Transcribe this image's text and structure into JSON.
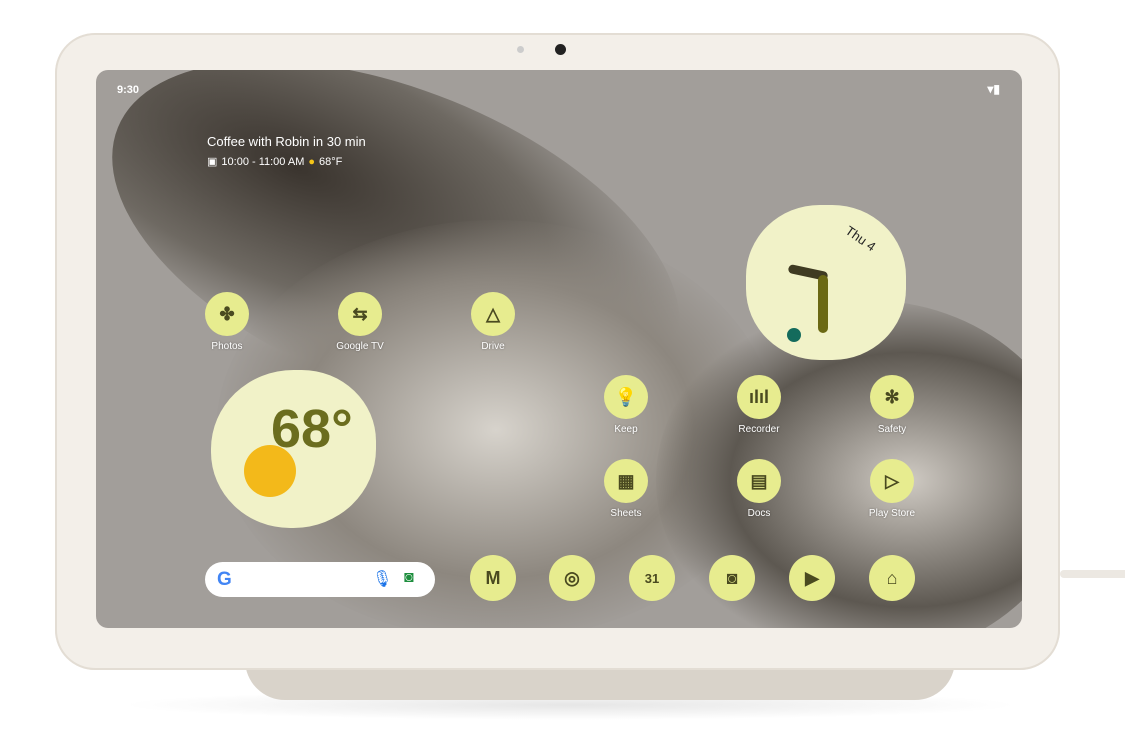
{
  "status": {
    "time": "9:30",
    "wifi_icon": "wifi-icon",
    "battery_icon": "battery-icon"
  },
  "event": {
    "title": "Coffee with Robin in 30 min",
    "time": "10:00 - 11:00 AM",
    "temp": "68°F"
  },
  "clock": {
    "date": "Thu 4"
  },
  "weather": {
    "temp": "68°"
  },
  "apps": [
    {
      "label": "Photos",
      "icon": "✤"
    },
    {
      "label": "Google TV",
      "icon": "⇆"
    },
    {
      "label": "Drive",
      "icon": "△"
    },
    {
      "label": "Keep",
      "icon": "💡"
    },
    {
      "label": "Recorder",
      "icon": "ılıl"
    },
    {
      "label": "Safety",
      "icon": "✻"
    },
    {
      "label": "Sheets",
      "icon": "▦"
    },
    {
      "label": "Docs",
      "icon": "▤"
    },
    {
      "label": "Play Store",
      "icon": "▷"
    }
  ],
  "dock": [
    {
      "name": "gmail",
      "icon": "M"
    },
    {
      "name": "chrome",
      "icon": "◎"
    },
    {
      "name": "calendar",
      "icon": "31"
    },
    {
      "name": "camera",
      "icon": "◙"
    },
    {
      "name": "youtube",
      "icon": "▶"
    },
    {
      "name": "home",
      "icon": "⌂"
    }
  ],
  "search": {
    "logo": "G",
    "mic_icon": "mic-icon",
    "lens_icon": "lens-icon"
  }
}
